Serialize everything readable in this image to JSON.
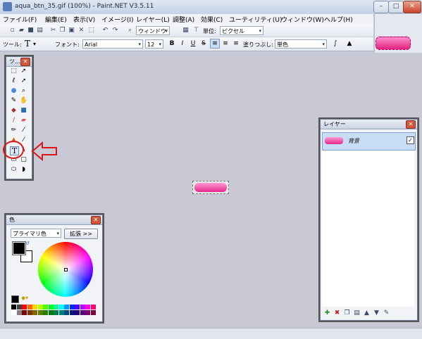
{
  "window": {
    "title": "aqua_btn_35.gif (100%) - Paint.NET V3.5.11",
    "min": "–",
    "max": "□",
    "close": "✕"
  },
  "menu": [
    "ファイル(F)",
    "編集(E)",
    "表示(V)",
    "イメージ(I)",
    "レイヤー(L)",
    "調整(A)",
    "効果(C)",
    "ユーティリティ(U)",
    "ウィンドウ(W)",
    "ヘルプ(H)"
  ],
  "toolbar1": {
    "window_label": "ウィンドウ",
    "unit_label": "単位:",
    "unit_value": "ピクセル"
  },
  "toolbar2": {
    "tool_label": "ツール:",
    "tool_glyph": "T",
    "font_label": "フォント:",
    "font_value": "Arial",
    "size_value": "12",
    "bold": "B",
    "italic": "I",
    "underline": "U",
    "strike": "S",
    "fill_label": "塗りつぶし:",
    "fill_value": "単色"
  },
  "tools_panel": {
    "title": "ツ…"
  },
  "layers_panel": {
    "title": "レイヤー",
    "layer_name": "背景",
    "checked": "✓"
  },
  "colors_panel": {
    "title": "色",
    "mode_value": "プライマリ色",
    "expand_label": "拡張 >>"
  },
  "arrow_icon": "arrow-left-outline-icon",
  "palette": [
    "#000000",
    "#404040",
    "#ff0000",
    "#ff6a00",
    "#ffd800",
    "#b6ff00",
    "#4cff00",
    "#00ff21",
    "#00ff90",
    "#00ffff",
    "#0094ff",
    "#0026ff",
    "#4800ff",
    "#b200ff",
    "#ff00dc",
    "#ff006e",
    "#ffffff",
    "#808080",
    "#7f0000",
    "#7f3300",
    "#7f6a00",
    "#5b7f00",
    "#267f00",
    "#007f0e",
    "#007f46",
    "#007f7f",
    "#004a7f",
    "#00137f",
    "#21007f",
    "#57007f",
    "#7f006e",
    "#7f0037"
  ]
}
